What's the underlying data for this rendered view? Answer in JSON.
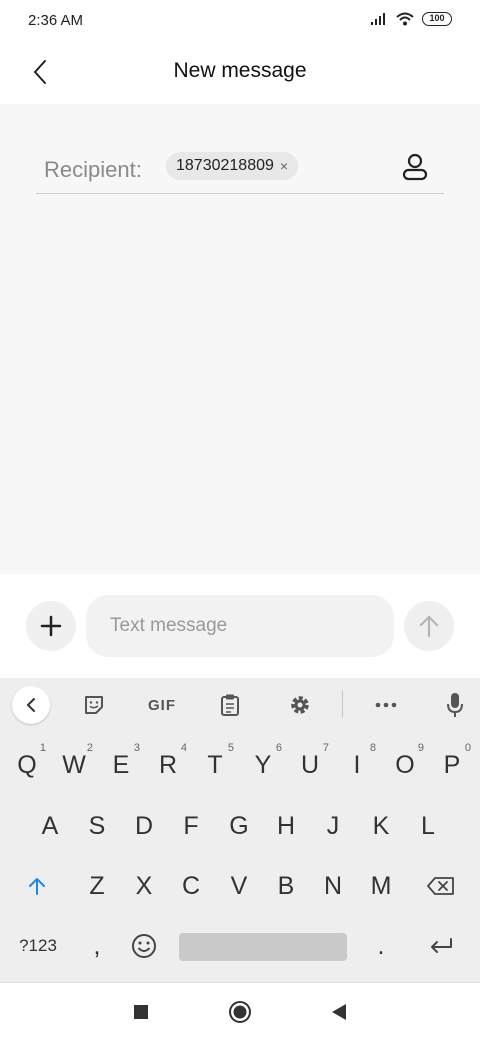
{
  "status_bar": {
    "time": "2:36 AM",
    "battery": "100"
  },
  "header": {
    "title": "New message"
  },
  "recipient": {
    "label": "Recipient:",
    "chip_number": "18730218809",
    "chip_close": "×"
  },
  "composer": {
    "placeholder": "Text message"
  },
  "keyboard": {
    "toolbar": [
      "back-arrow",
      "sticker",
      "GIF",
      "clipboard",
      "settings",
      "more",
      "microphone"
    ],
    "gif_label": "GIF",
    "row1": [
      {
        "key": "Q",
        "hint": "1"
      },
      {
        "key": "W",
        "hint": "2"
      },
      {
        "key": "E",
        "hint": "3"
      },
      {
        "key": "R",
        "hint": "4"
      },
      {
        "key": "T",
        "hint": "5"
      },
      {
        "key": "Y",
        "hint": "6"
      },
      {
        "key": "U",
        "hint": "7"
      },
      {
        "key": "I",
        "hint": "8"
      },
      {
        "key": "O",
        "hint": "9"
      },
      {
        "key": "P",
        "hint": "0"
      }
    ],
    "row2": [
      "A",
      "S",
      "D",
      "F",
      "G",
      "H",
      "J",
      "K",
      "L"
    ],
    "row3": [
      "Z",
      "X",
      "C",
      "V",
      "B",
      "N",
      "M"
    ],
    "row4": {
      "symbols": "?123",
      "comma": ",",
      "period": "."
    }
  },
  "colors": {
    "accent": "#1e88e5",
    "background": "#f7f7f7",
    "keyboard_bg": "#eeeeee"
  }
}
